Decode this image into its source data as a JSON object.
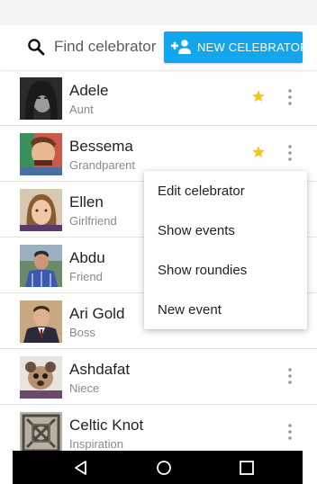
{
  "toolbar": {
    "search_placeholder": "Find celebrator",
    "new_button_label": "NEW CELEBRATOR",
    "accent_color": "#11a6ee"
  },
  "contacts": [
    {
      "name": "Adele",
      "relation": "Aunt",
      "favorite": true,
      "avatar_icon": "avatar-photo"
    },
    {
      "name": "Bessema",
      "relation": "Grandparent",
      "favorite": true,
      "avatar_icon": "avatar-photo"
    },
    {
      "name": "Ellen",
      "relation": "Girlfriend",
      "favorite": false,
      "avatar_icon": "avatar-photo"
    },
    {
      "name": "Abdu",
      "relation": "Friend",
      "favorite": false,
      "avatar_icon": "avatar-photo"
    },
    {
      "name": "Ari Gold",
      "relation": "Boss",
      "favorite": false,
      "avatar_icon": "avatar-photo"
    },
    {
      "name": "Ashdafat",
      "relation": "Niece",
      "favorite": false,
      "avatar_icon": "avatar-photo"
    },
    {
      "name": "Celtic Knot",
      "relation": "Inspiration",
      "favorite": false,
      "avatar_icon": "avatar-photo"
    }
  ],
  "context_menu": {
    "items": [
      {
        "label": "Edit celebrator"
      },
      {
        "label": "Show events"
      },
      {
        "label": "Show roundies"
      },
      {
        "label": "New event"
      }
    ]
  },
  "navbar": {
    "icons": [
      "back-icon",
      "home-icon",
      "recents-icon"
    ]
  },
  "colors": {
    "star": "#f5c518",
    "navbar": "#000000"
  }
}
